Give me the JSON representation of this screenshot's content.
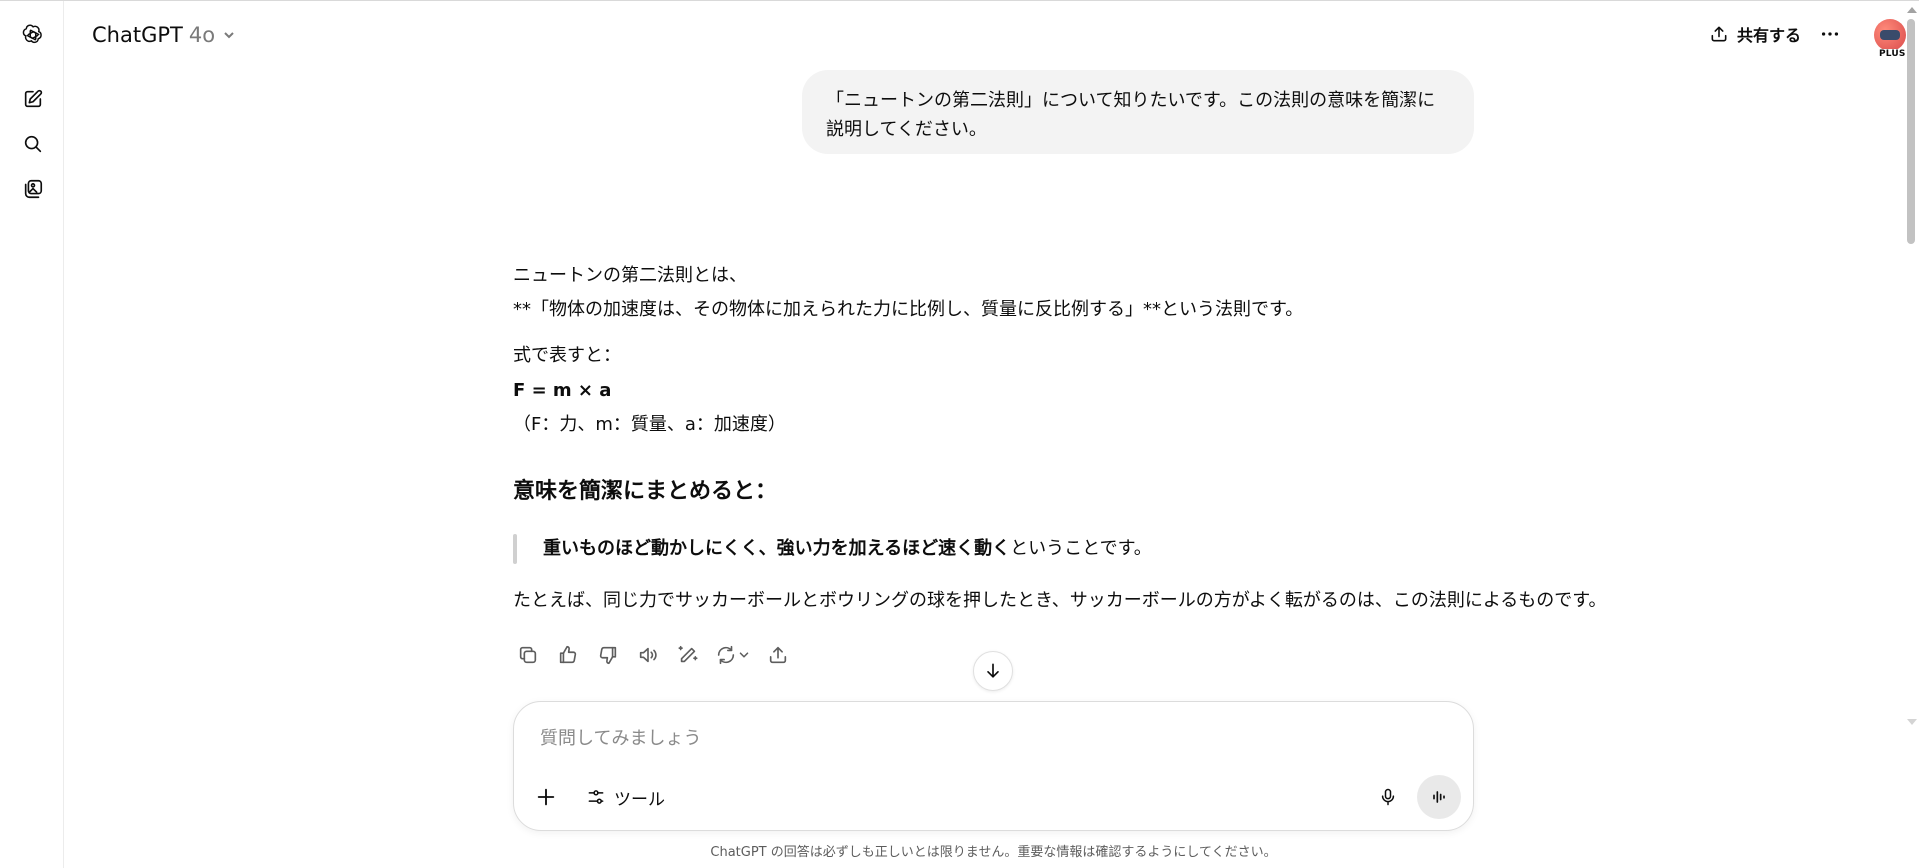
{
  "header": {
    "model_name": "ChatGPT",
    "model_version": "4o",
    "share_label": "共有する",
    "plan_badge": "PLUS"
  },
  "sidebar": {
    "items": [
      {
        "name": "openai-logo-icon"
      },
      {
        "name": "new-chat-icon"
      },
      {
        "name": "search-icon"
      },
      {
        "name": "library-icon"
      }
    ]
  },
  "conversation": {
    "user_message": "「ニュートンの第二法則」について知りたいです。この法則の意味を簡潔に説明してください。",
    "assistant": {
      "line1": "ニュートンの第二法則とは、",
      "line2": "**「物体の加速度は、その物体に加えられた力に比例し、質量に反比例する」**という法則です。",
      "formula_intro": "式で表すと：",
      "formula": "F = m × a",
      "formula_legend": "（F：力、m：質量、a：加速度）",
      "heading": "意味を簡潔にまとめると：",
      "quote_bold": "重いものほど動かしにくく、強い力を加えるほど速く動く",
      "quote_rest": "ということです。",
      "example": "たとえば、同じ力でサッカーボールとボウリングの球を押したとき、サッカーボールの方がよく転がるのは、この法則によるものです。"
    },
    "actions": [
      "copy-icon",
      "thumbs-up-icon",
      "thumbs-down-icon",
      "read-aloud-icon",
      "edit-canvas-icon",
      "regenerate-icon",
      "share-icon"
    ]
  },
  "composer": {
    "placeholder": "質問してみましょう",
    "value": "",
    "tools_label": "ツール"
  },
  "footer": {
    "note": "ChatGPT の回答は必ずしも正しいとは限りません。重要な情報は確認するようにしてください。"
  },
  "colors": {
    "bubble_bg": "#f3f3f3",
    "text": "#0d0d0d",
    "muted": "#5d5d5d",
    "voice_button_bg": "#e9e9e9"
  }
}
